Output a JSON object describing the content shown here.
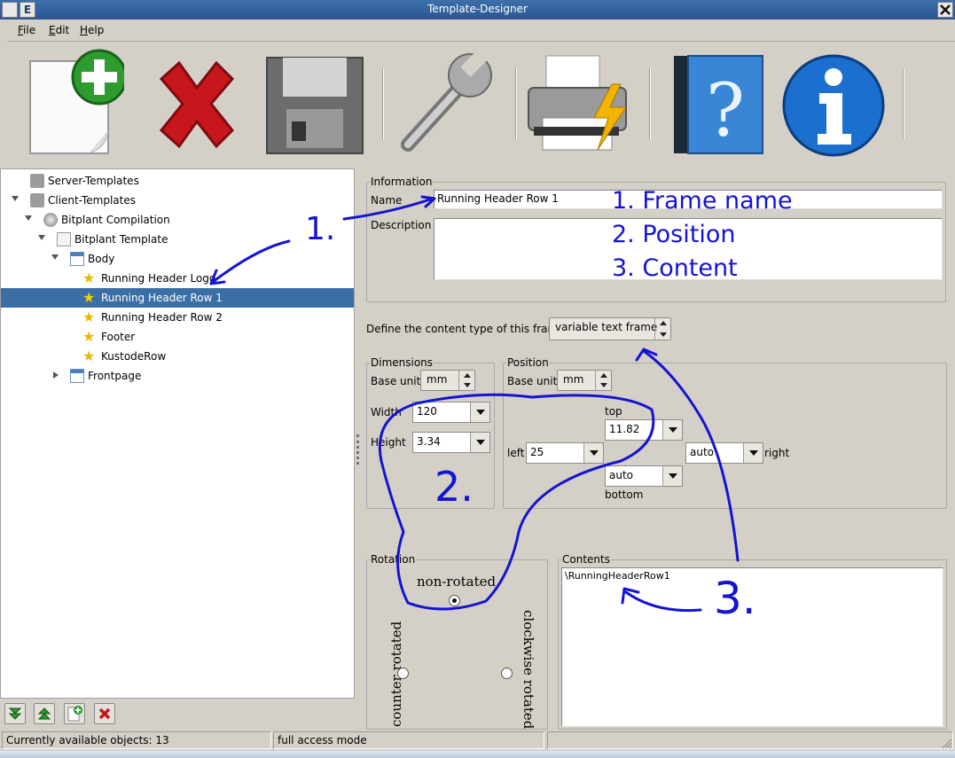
{
  "window": {
    "title": "Template-Designer",
    "left_btn": "E"
  },
  "menu": [
    "File",
    "Edit",
    "Help"
  ],
  "toolbar": [
    "new-template-icon",
    "delete-icon",
    "save-disk-icon",
    "wrench-icon",
    "print-icon",
    "help-book-icon",
    "info-icon"
  ],
  "tree": {
    "items": [
      {
        "label": "Server-Templates"
      },
      {
        "label": "Client-Templates"
      },
      {
        "label": "Bitplant Compilation"
      },
      {
        "label": "Bitplant Template"
      },
      {
        "label": "Body"
      },
      {
        "label": "Running Header Logo"
      },
      {
        "label": "Running Header Row 1"
      },
      {
        "label": "Running Header Row 2"
      },
      {
        "label": "Footer"
      },
      {
        "label": "KustodeRow"
      },
      {
        "label": "Frontpage"
      }
    ]
  },
  "status": {
    "objects": "Currently available objects: 13",
    "mode": "full access mode"
  },
  "info": {
    "title": "Information",
    "name_label": "Name",
    "name_value": "Running Header Row 1",
    "desc_label": "Description",
    "desc_value": ""
  },
  "content_type": {
    "label": "Define the content type of this frame",
    "value": "variable text frame"
  },
  "dimensions": {
    "title": "Dimensions",
    "base_unit_label": "Base unit",
    "base_unit": "mm",
    "width_label": "Width",
    "width": "120",
    "height_label": "Height",
    "height": "3.34"
  },
  "position": {
    "title": "Position",
    "base_unit_label": "Base unit",
    "base_unit": "mm",
    "top_label": "top",
    "top": "11.82",
    "left_label": "left",
    "left": "25",
    "right_label": "right",
    "right": "auto",
    "bottom_label": "bottom",
    "bottom": "auto"
  },
  "rotation": {
    "title": "Rotation",
    "non_rotated": "non-rotated",
    "counter": "counter rotated",
    "clockwise": "clockwise rotated"
  },
  "contents": {
    "title": "Contents",
    "value": "\\RunningHeaderRow1"
  },
  "annotations": {
    "a1": "1.",
    "a2": "2.",
    "a3": "3.",
    "list1": "1. Frame name",
    "list2": "2. Position",
    "list3": "3. Content"
  },
  "colors": {
    "annotation": "#1414d2",
    "selection": "#3b6ea5",
    "title_bar": "#2a5691"
  }
}
